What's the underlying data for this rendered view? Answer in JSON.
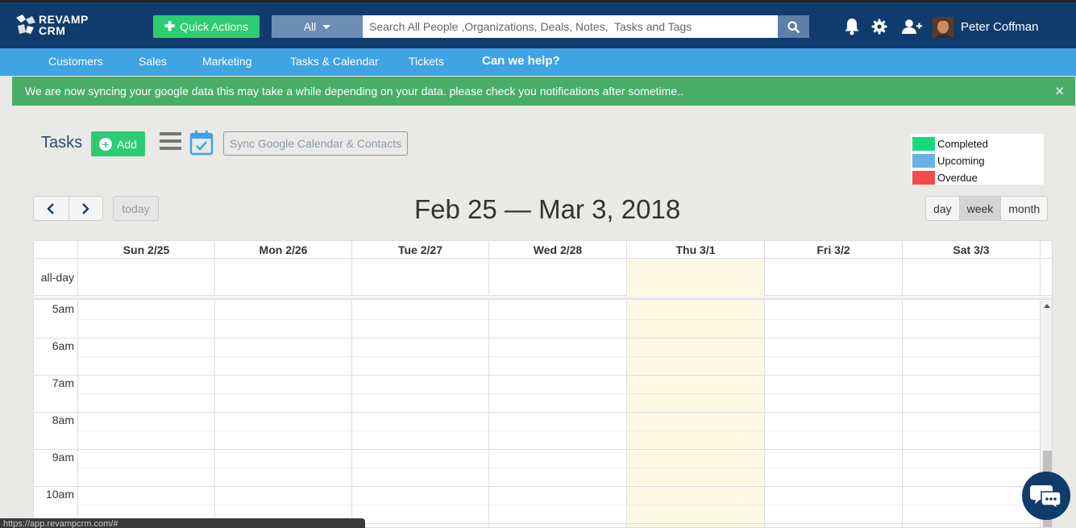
{
  "app": {
    "logo_line1": "REVAMP",
    "logo_line2": "CRM"
  },
  "header": {
    "quick_actions_label": "Quick Actions",
    "search_scope": "All",
    "search_placeholder": "Search All People ,Organizations, Deals, Notes,  Tasks and Tags",
    "icons": [
      "bell-icon",
      "gear-icon",
      "add-user-icon",
      "search-icon"
    ],
    "user_name": "Peter Coffman"
  },
  "nav": {
    "items": [
      {
        "label": "Customers"
      },
      {
        "label": "Sales"
      },
      {
        "label": "Marketing"
      },
      {
        "label": "Tasks & Calendar"
      },
      {
        "label": "Tickets"
      },
      {
        "label": "Can we help?"
      }
    ]
  },
  "alert": {
    "message": "We are now syncing your google data this may take a while depending on your data. please check you notifications after sometime..",
    "close_label": "×"
  },
  "tasks": {
    "title": "Tasks",
    "add_label": "Add",
    "sync_label": "Sync Google Calendar & Contacts"
  },
  "legend": [
    {
      "label": "Completed",
      "color": "#16d97c"
    },
    {
      "label": "Upcoming",
      "color": "#6ab0e8"
    },
    {
      "label": "Overdue",
      "color": "#f44a4a"
    }
  ],
  "calendar": {
    "today_label": "today",
    "range_title": "Feb 25 — Mar 3, 2018",
    "views": [
      {
        "label": "day",
        "active": false
      },
      {
        "label": "week",
        "active": true
      },
      {
        "label": "month",
        "active": false
      }
    ],
    "days": [
      "Sun 2/25",
      "Mon 2/26",
      "Tue 2/27",
      "Wed 2/28",
      "Thu 3/1",
      "Fri 3/2",
      "Sat 3/3"
    ],
    "today_index": 4,
    "all_day_label": "all-day",
    "hours": [
      "5am",
      "6am",
      "7am",
      "8am",
      "9am",
      "10am"
    ],
    "today_color": "#fcf8e3"
  },
  "status_bar": {
    "url": "https://app.revampcrm.com/#"
  }
}
